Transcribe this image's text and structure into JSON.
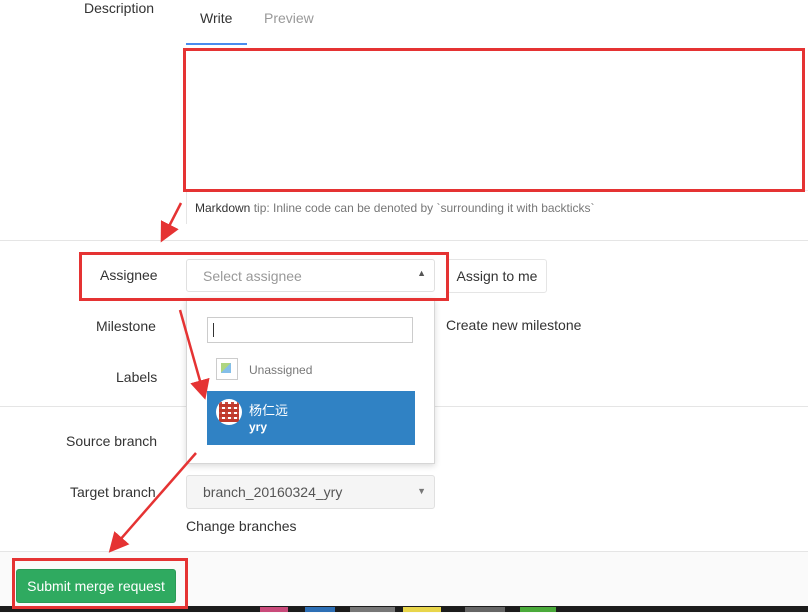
{
  "form": {
    "description_label": "Description",
    "tabs": [
      {
        "label": "Write"
      },
      {
        "label": "Preview"
      }
    ],
    "markdown_hint": {
      "bold": "Markdown",
      "rest": " tip: Inline code can be denoted by `surrounding it with backticks`"
    },
    "assignee": {
      "label": "Assignee",
      "placeholder": "Select assignee",
      "assign_to_me": "Assign to me"
    },
    "milestone": {
      "label": "Milestone",
      "create_new": "Create new milestone"
    },
    "labels": {
      "label": "Labels"
    },
    "assignee_dropdown": {
      "search_value": "",
      "items": [
        {
          "name": "Unassigned"
        },
        {
          "name": "杨仁远",
          "username": "yry",
          "highlighted": true
        }
      ]
    },
    "source_branch": {
      "label": "Source branch"
    },
    "target_branch": {
      "label": "Target branch",
      "value": "branch_20160324_yry"
    },
    "change_branches": "Change branches",
    "submit_button": "Submit merge request"
  },
  "colors": {
    "accent_tab": "#4a8bee",
    "highlight": "#3082c4",
    "submit": "#2faa60",
    "annotation": "#e53333"
  },
  "icons": [
    "caret-up-icon",
    "caret-down-icon",
    "broken-image-icon",
    "user-avatar"
  ]
}
